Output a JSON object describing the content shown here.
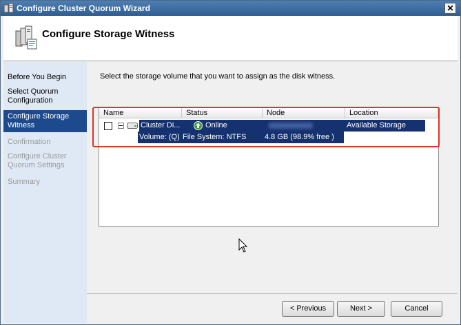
{
  "window": {
    "title": "Configure Cluster Quorum Wizard",
    "close_glyph": "✕"
  },
  "header": {
    "heading": "Configure Storage Witness"
  },
  "nav": {
    "items": [
      {
        "label": "Before You Begin",
        "state": "normal"
      },
      {
        "label": "Select Quorum Configuration",
        "state": "normal"
      },
      {
        "label": "Configure Storage Witness",
        "state": "active"
      },
      {
        "label": "Confirmation",
        "state": "disabled"
      },
      {
        "label": "Configure Cluster Quorum Settings",
        "state": "disabled"
      },
      {
        "label": "Summary",
        "state": "disabled"
      }
    ]
  },
  "main": {
    "instruction": "Select the storage volume that you want to assign as the disk witness.",
    "columns": [
      "Name",
      "Status",
      "Node",
      "Location"
    ],
    "rows": [
      {
        "name": "Cluster Di...",
        "status": "Online",
        "location": "Available Storage"
      },
      {
        "name": "Volume: (Q)",
        "status": "File System: NTFS",
        "node": "4.8 GB (98.9% free )"
      }
    ]
  },
  "buttons": {
    "previous": "< Previous",
    "next": "Next >",
    "cancel": "Cancel"
  },
  "colors": {
    "selection": "#16316f",
    "nav_active": "#1c4a8d",
    "highlight": "#e0332b",
    "online": "#3a9a3a"
  },
  "icons": [
    "wizard-cluster-icon",
    "close-icon",
    "disk-icon",
    "online-status-icon",
    "mouse-cursor-icon"
  ]
}
